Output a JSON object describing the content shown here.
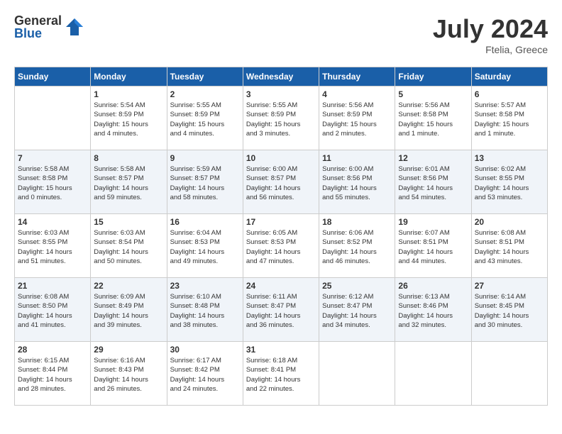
{
  "logo": {
    "general": "General",
    "blue": "Blue"
  },
  "title": "July 2024",
  "location": "Ftelia, Greece",
  "days_of_week": [
    "Sunday",
    "Monday",
    "Tuesday",
    "Wednesday",
    "Thursday",
    "Friday",
    "Saturday"
  ],
  "weeks": [
    [
      {
        "day": "",
        "info": ""
      },
      {
        "day": "1",
        "info": "Sunrise: 5:54 AM\nSunset: 8:59 PM\nDaylight: 15 hours\nand 4 minutes."
      },
      {
        "day": "2",
        "info": "Sunrise: 5:55 AM\nSunset: 8:59 PM\nDaylight: 15 hours\nand 4 minutes."
      },
      {
        "day": "3",
        "info": "Sunrise: 5:55 AM\nSunset: 8:59 PM\nDaylight: 15 hours\nand 3 minutes."
      },
      {
        "day": "4",
        "info": "Sunrise: 5:56 AM\nSunset: 8:59 PM\nDaylight: 15 hours\nand 2 minutes."
      },
      {
        "day": "5",
        "info": "Sunrise: 5:56 AM\nSunset: 8:58 PM\nDaylight: 15 hours\nand 1 minute."
      },
      {
        "day": "6",
        "info": "Sunrise: 5:57 AM\nSunset: 8:58 PM\nDaylight: 15 hours\nand 1 minute."
      }
    ],
    [
      {
        "day": "7",
        "info": "Sunrise: 5:58 AM\nSunset: 8:58 PM\nDaylight: 15 hours\nand 0 minutes."
      },
      {
        "day": "8",
        "info": "Sunrise: 5:58 AM\nSunset: 8:57 PM\nDaylight: 14 hours\nand 59 minutes."
      },
      {
        "day": "9",
        "info": "Sunrise: 5:59 AM\nSunset: 8:57 PM\nDaylight: 14 hours\nand 58 minutes."
      },
      {
        "day": "10",
        "info": "Sunrise: 6:00 AM\nSunset: 8:57 PM\nDaylight: 14 hours\nand 56 minutes."
      },
      {
        "day": "11",
        "info": "Sunrise: 6:00 AM\nSunset: 8:56 PM\nDaylight: 14 hours\nand 55 minutes."
      },
      {
        "day": "12",
        "info": "Sunrise: 6:01 AM\nSunset: 8:56 PM\nDaylight: 14 hours\nand 54 minutes."
      },
      {
        "day": "13",
        "info": "Sunrise: 6:02 AM\nSunset: 8:55 PM\nDaylight: 14 hours\nand 53 minutes."
      }
    ],
    [
      {
        "day": "14",
        "info": "Sunrise: 6:03 AM\nSunset: 8:55 PM\nDaylight: 14 hours\nand 51 minutes."
      },
      {
        "day": "15",
        "info": "Sunrise: 6:03 AM\nSunset: 8:54 PM\nDaylight: 14 hours\nand 50 minutes."
      },
      {
        "day": "16",
        "info": "Sunrise: 6:04 AM\nSunset: 8:53 PM\nDaylight: 14 hours\nand 49 minutes."
      },
      {
        "day": "17",
        "info": "Sunrise: 6:05 AM\nSunset: 8:53 PM\nDaylight: 14 hours\nand 47 minutes."
      },
      {
        "day": "18",
        "info": "Sunrise: 6:06 AM\nSunset: 8:52 PM\nDaylight: 14 hours\nand 46 minutes."
      },
      {
        "day": "19",
        "info": "Sunrise: 6:07 AM\nSunset: 8:51 PM\nDaylight: 14 hours\nand 44 minutes."
      },
      {
        "day": "20",
        "info": "Sunrise: 6:08 AM\nSunset: 8:51 PM\nDaylight: 14 hours\nand 43 minutes."
      }
    ],
    [
      {
        "day": "21",
        "info": "Sunrise: 6:08 AM\nSunset: 8:50 PM\nDaylight: 14 hours\nand 41 minutes."
      },
      {
        "day": "22",
        "info": "Sunrise: 6:09 AM\nSunset: 8:49 PM\nDaylight: 14 hours\nand 39 minutes."
      },
      {
        "day": "23",
        "info": "Sunrise: 6:10 AM\nSunset: 8:48 PM\nDaylight: 14 hours\nand 38 minutes."
      },
      {
        "day": "24",
        "info": "Sunrise: 6:11 AM\nSunset: 8:47 PM\nDaylight: 14 hours\nand 36 minutes."
      },
      {
        "day": "25",
        "info": "Sunrise: 6:12 AM\nSunset: 8:47 PM\nDaylight: 14 hours\nand 34 minutes."
      },
      {
        "day": "26",
        "info": "Sunrise: 6:13 AM\nSunset: 8:46 PM\nDaylight: 14 hours\nand 32 minutes."
      },
      {
        "day": "27",
        "info": "Sunrise: 6:14 AM\nSunset: 8:45 PM\nDaylight: 14 hours\nand 30 minutes."
      }
    ],
    [
      {
        "day": "28",
        "info": "Sunrise: 6:15 AM\nSunset: 8:44 PM\nDaylight: 14 hours\nand 28 minutes."
      },
      {
        "day": "29",
        "info": "Sunrise: 6:16 AM\nSunset: 8:43 PM\nDaylight: 14 hours\nand 26 minutes."
      },
      {
        "day": "30",
        "info": "Sunrise: 6:17 AM\nSunset: 8:42 PM\nDaylight: 14 hours\nand 24 minutes."
      },
      {
        "day": "31",
        "info": "Sunrise: 6:18 AM\nSunset: 8:41 PM\nDaylight: 14 hours\nand 22 minutes."
      },
      {
        "day": "",
        "info": ""
      },
      {
        "day": "",
        "info": ""
      },
      {
        "day": "",
        "info": ""
      }
    ]
  ]
}
